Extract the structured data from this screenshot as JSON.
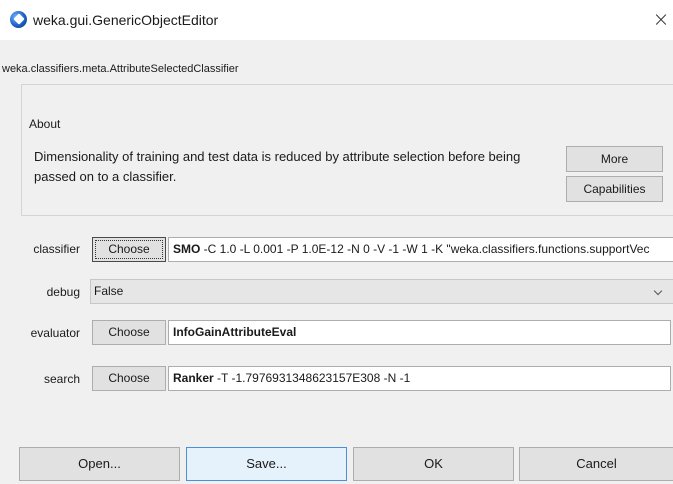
{
  "window": {
    "title": "weka.gui.GenericObjectEditor",
    "close_glyph": "×",
    "app_icon": "weka-bird-icon"
  },
  "object_class": "weka.classifiers.meta.AttributeSelectedClassifier",
  "about": {
    "label": "About",
    "text": "Dimensionality of training and test data is reduced by attribute selection before being passed on to a classifier.",
    "more_label": "More",
    "capabilities_label": "Capabilities"
  },
  "properties": {
    "classifier": {
      "label": "classifier",
      "choose_label": "Choose",
      "value_name": "SMO",
      "value_args": " -C 1.0 -L 0.001 -P 1.0E-12 -N 0 -V -1 -W 1 -K \"weka.classifiers.functions.supportVec"
    },
    "debug": {
      "label": "debug",
      "selected": "False"
    },
    "evaluator": {
      "label": "evaluator",
      "choose_label": "Choose",
      "value_name": "InfoGainAttributeEval",
      "value_args": ""
    },
    "search": {
      "label": "search",
      "choose_label": "Choose",
      "value_name": "Ranker",
      "value_args": " -T -1.7976931348623157E308 -N -1"
    }
  },
  "buttons": {
    "open": "Open...",
    "save": "Save...",
    "ok": "OK",
    "cancel": "Cancel"
  },
  "colors": {
    "panel_bg": "#f0f0f0",
    "button_bg": "#e1e1e1",
    "hover_bg": "#e5f1fb",
    "hover_border": "#4a90d9"
  }
}
